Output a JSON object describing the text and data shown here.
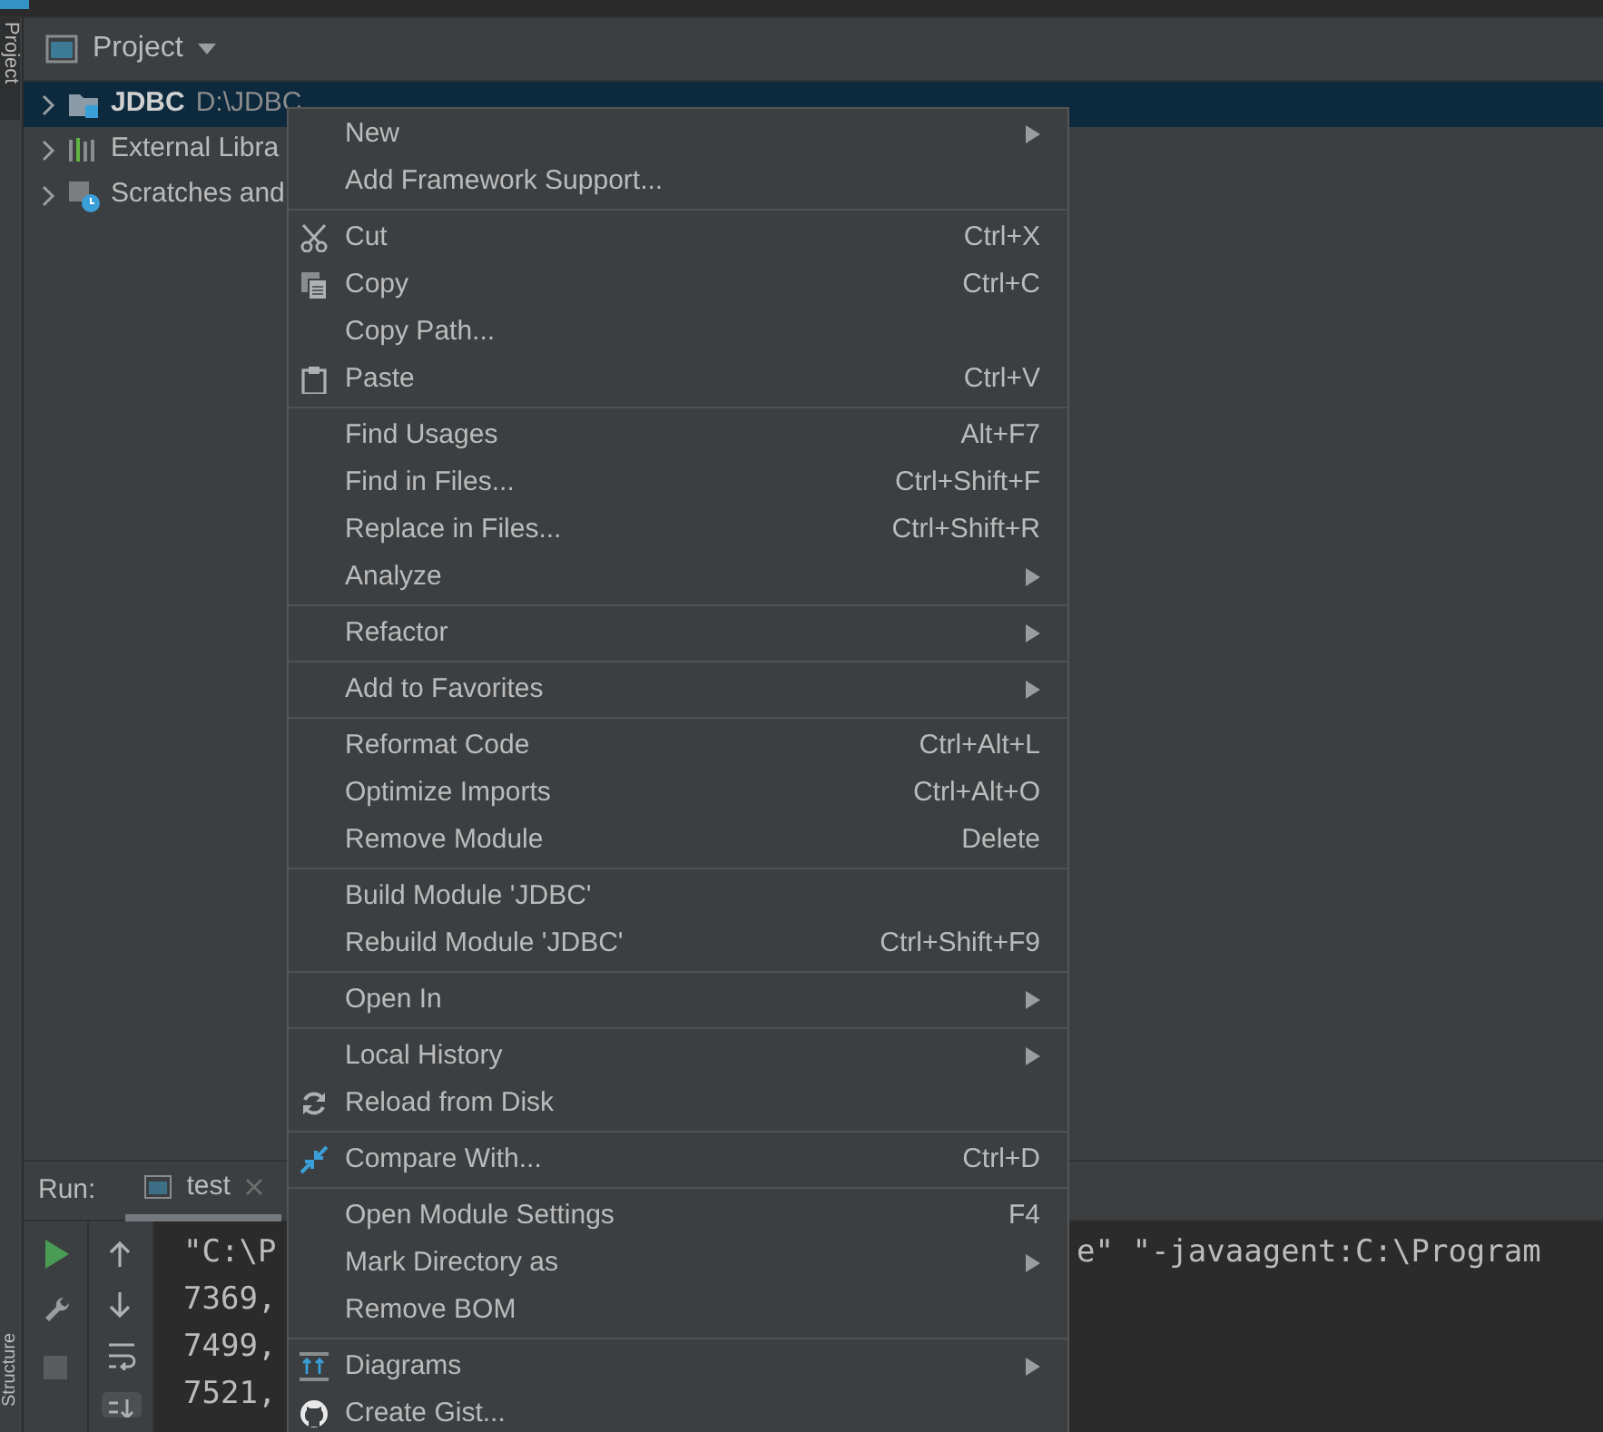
{
  "side_stripe": {
    "top_tab": "Project",
    "bottom_tab": "Structure"
  },
  "project_panel": {
    "title": "Project",
    "tree": [
      {
        "label": "JDBC",
        "path": "D:\\JDBC",
        "kind": "module",
        "selected": true
      },
      {
        "label": "External Libra",
        "kind": "libraries",
        "selected": false
      },
      {
        "label": "Scratches and",
        "kind": "scratches",
        "selected": false
      }
    ]
  },
  "context_menu": {
    "groups": [
      {
        "items": [
          {
            "label": "New",
            "submenu": true
          },
          {
            "label": "Add Framework Support...",
            "submenu": false
          }
        ]
      },
      {
        "items": [
          {
            "label": "Cut",
            "shortcut": "Ctrl+X",
            "kind": "scissors",
            "submenu": false
          },
          {
            "label": "Copy",
            "shortcut": "Ctrl+C",
            "kind": "copy",
            "submenu": false
          },
          {
            "label": "Copy Path...",
            "submenu": false
          },
          {
            "label": "Paste",
            "shortcut": "Ctrl+V",
            "kind": "clipboard",
            "submenu": false
          }
        ]
      },
      {
        "items": [
          {
            "label": "Find Usages",
            "shortcut": "Alt+F7",
            "submenu": false
          },
          {
            "label": "Find in Files...",
            "shortcut": "Ctrl+Shift+F",
            "submenu": false
          },
          {
            "label": "Replace in Files...",
            "shortcut": "Ctrl+Shift+R",
            "submenu": false
          },
          {
            "label": "Analyze",
            "submenu": true
          }
        ]
      },
      {
        "items": [
          {
            "label": "Refactor",
            "submenu": true
          }
        ]
      },
      {
        "items": [
          {
            "label": "Add to Favorites",
            "submenu": true
          }
        ]
      },
      {
        "items": [
          {
            "label": "Reformat Code",
            "shortcut": "Ctrl+Alt+L",
            "submenu": false
          },
          {
            "label": "Optimize Imports",
            "shortcut": "Ctrl+Alt+O",
            "submenu": false
          },
          {
            "label": "Remove Module",
            "shortcut": "Delete",
            "submenu": false
          }
        ]
      },
      {
        "items": [
          {
            "label": "Build Module 'JDBC'",
            "submenu": false
          },
          {
            "label": "Rebuild Module 'JDBC'",
            "shortcut": "Ctrl+Shift+F9",
            "submenu": false
          }
        ]
      },
      {
        "items": [
          {
            "label": "Open In",
            "submenu": true
          }
        ]
      },
      {
        "items": [
          {
            "label": "Local History",
            "submenu": true
          },
          {
            "label": "Reload from Disk",
            "kind": "reload",
            "submenu": false
          }
        ]
      },
      {
        "items": [
          {
            "label": "Compare With...",
            "shortcut": "Ctrl+D",
            "kind": "compare",
            "submenu": false
          }
        ]
      },
      {
        "items": [
          {
            "label": "Open Module Settings",
            "shortcut": "F4",
            "submenu": false
          },
          {
            "label": "Mark Directory as",
            "submenu": true
          },
          {
            "label": "Remove BOM",
            "submenu": false
          }
        ]
      },
      {
        "items": [
          {
            "label": "Diagrams",
            "kind": "diagram",
            "submenu": true
          },
          {
            "label": "Create Gist...",
            "kind": "octocat",
            "submenu": false
          }
        ]
      }
    ]
  },
  "run_panel": {
    "label": "Run:",
    "tabs": [
      {
        "label": "test",
        "selected": true
      }
    ],
    "console_lines": [
      "\"C:\\P",
      "7369,",
      "7499,",
      "7521,"
    ],
    "console_right": "e\" \"-javaagent:C:\\Program"
  }
}
